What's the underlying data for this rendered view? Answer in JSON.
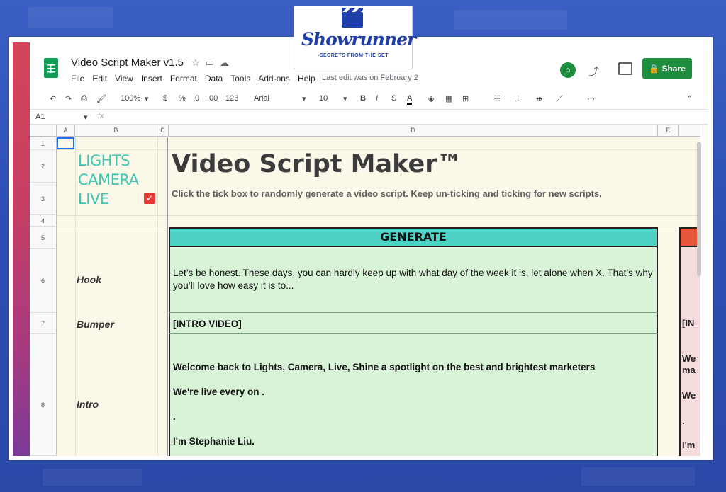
{
  "doc": {
    "title": "Video Script Maker v1.5",
    "last_edit": "Last edit was on February 2"
  },
  "menu": [
    "File",
    "Edit",
    "View",
    "Insert",
    "Format",
    "Data",
    "Tools",
    "Add-ons",
    "Help"
  ],
  "share_label": "Share",
  "toolbar": {
    "zoom": "100%",
    "currency": "$",
    "percent": "%",
    "dec_less": ".0",
    "dec_more": ".00",
    "fmt": "123",
    "font": "Arial",
    "size": "10",
    "bold": "B",
    "italic": "I",
    "strike": "S",
    "color": "A"
  },
  "formula": {
    "cell_ref": "A1",
    "fx": "fx"
  },
  "columns": [
    "A",
    "B",
    "C",
    "D",
    "E"
  ],
  "rows": [
    "1",
    "2",
    "3",
    "4",
    "5",
    "6",
    "7",
    "8"
  ],
  "brand": {
    "line1": "LIGHTS",
    "line2": "CAMERA",
    "line3": "LIVE"
  },
  "sheet": {
    "title": "Video Script Maker™",
    "subtitle": "Click the tick box to randomly generate a video script. Keep un-ticking and ticking for new scripts.",
    "generate": "GENERATE",
    "hook_label": "Hook",
    "hook_text": "Let’s be honest. These days, you can hardly keep up with what day of the week it is, let alone when X. That’s why you’ll love how easy it is to...",
    "bumper_label": "Bumper",
    "bumper_text": "[INTRO VIDEO]",
    "intro_label": "Intro",
    "intro_l1": "Welcome back to Lights, Camera, Live, Shine a spotlight on the best and brightest marketers",
    "intro_l2": "We're live every  on .",
    "intro_l3": ".",
    "intro_l4": "I'm Stephanie Liu."
  },
  "side": {
    "r7": "[IN",
    "r8a": "We",
    "r8b": "ma",
    "r8c": "We",
    "r8d": ".",
    "r8e": "I'm"
  },
  "overlay": {
    "name": "Showrunner",
    "tagline": "-SECRETS FROM THE SET"
  }
}
